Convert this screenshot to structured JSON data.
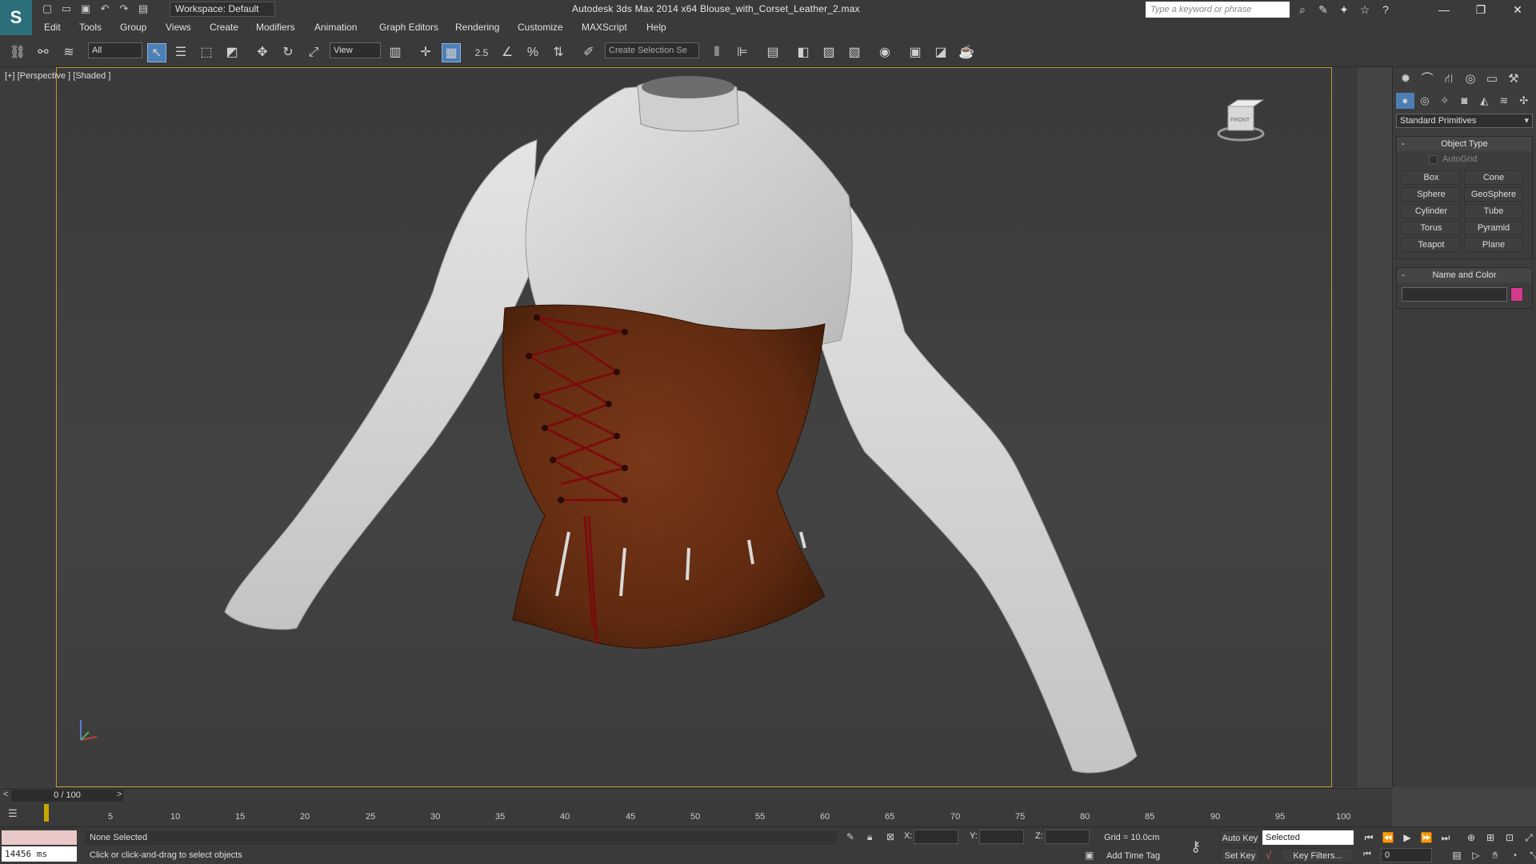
{
  "window": {
    "title": "Autodesk 3ds Max  2014 x64     Blouse_with_Corset_Leather_2.max",
    "workspace": "Workspace: Default",
    "search_placeholder": "Type a keyword or phrase",
    "controls": [
      "—",
      "❐",
      "✕"
    ]
  },
  "menu": [
    "Edit",
    "Tools",
    "Group",
    "Views",
    "Create",
    "Modifiers",
    "Animation",
    "Graph Editors",
    "Rendering",
    "Customize",
    "MAXScript",
    "Help"
  ],
  "toolbar": {
    "filter_value": "All",
    "ref_coord": "View",
    "snap_value": "2.5",
    "selection_set_placeholder": "Create Selection Se"
  },
  "viewport": {
    "label": "[+] [Perspective ] [Shaded ]",
    "viewcube_text": "FRONT"
  },
  "command_panel": {
    "category": "Standard Primitives",
    "object_type_title": "Object Type",
    "autogrid": "AutoGrid",
    "buttons": [
      "Box",
      "Cone",
      "Sphere",
      "GeoSphere",
      "Cylinder",
      "Tube",
      "Torus",
      "Pyramid",
      "Teapot",
      "Plane"
    ],
    "name_color_title": "Name and Color",
    "object_color": "#d63a8f"
  },
  "timeline": {
    "slider_text": "0 / 100",
    "ticks": [
      "5",
      "10",
      "15",
      "20",
      "25",
      "30",
      "35",
      "40",
      "45",
      "50",
      "55",
      "60",
      "65",
      "70",
      "75",
      "80",
      "85",
      "90",
      "95",
      "100"
    ]
  },
  "status": {
    "render_time": "14456 ms",
    "selection": "None Selected",
    "prompt": "Click or click-and-drag to select objects",
    "x_label": "X:",
    "y_label": "Y:",
    "z_label": "Z:",
    "grid": "Grid = 10.0cm",
    "add_time_tag": "Add Time Tag",
    "auto_key": "Auto Key",
    "set_key": "Set Key",
    "key_mode": "Selected",
    "key_filters": "Key Filters...",
    "frame": "0"
  },
  "colors": {
    "corset": "#6b2e12",
    "blouse": "#d4d4d4",
    "lacing": "#7a0c0c",
    "viewport_border": "#b89a30"
  }
}
